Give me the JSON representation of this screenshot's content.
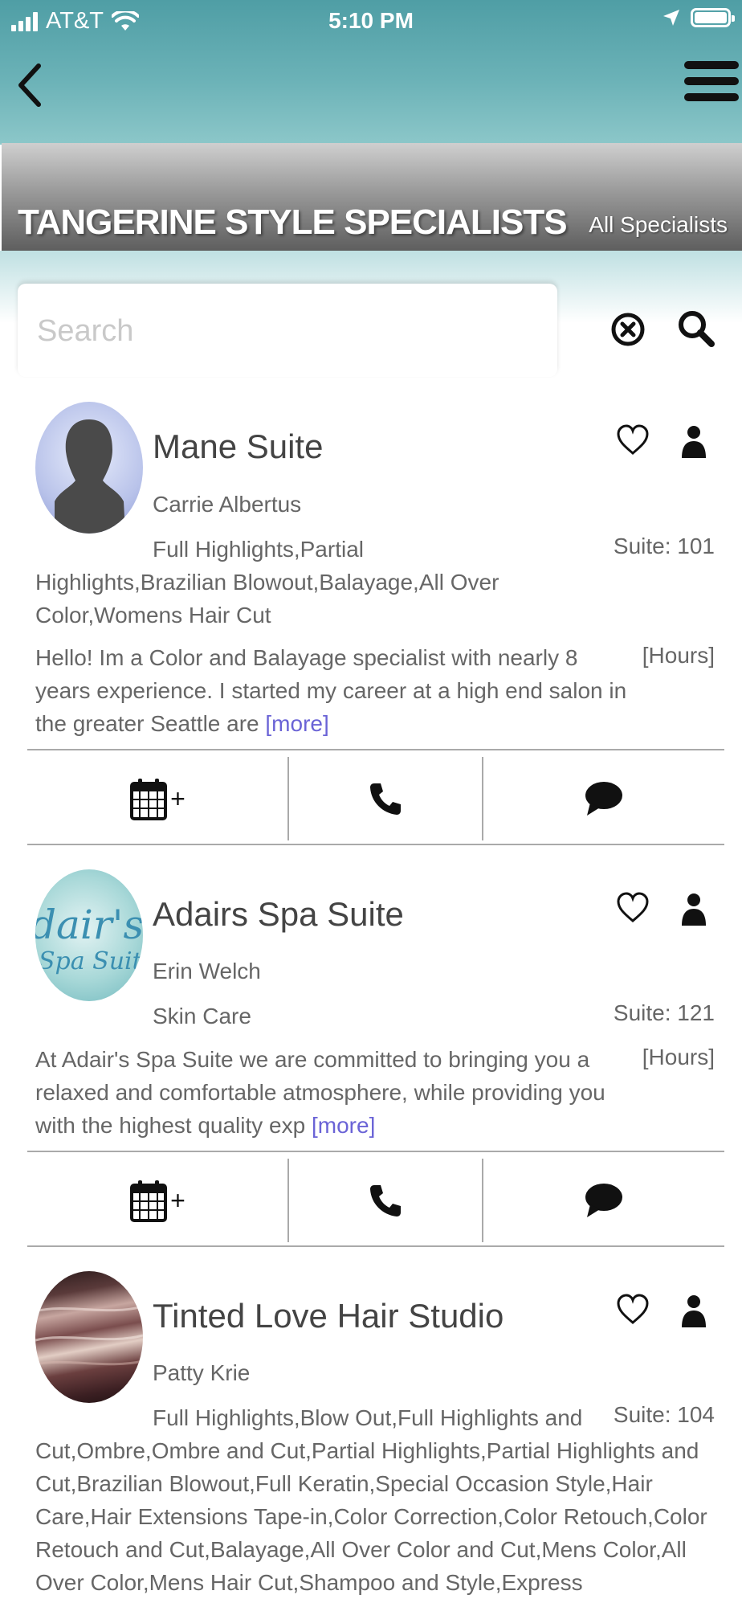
{
  "status_bar": {
    "carrier": "AT&T",
    "time": "5:10 PM"
  },
  "header": {
    "title": "TANGERINE STYLE SPECIALISTS",
    "all_specialists_label": "All Specialists"
  },
  "search": {
    "placeholder": "Search",
    "value": ""
  },
  "specialists": [
    {
      "business": "Mane Suite",
      "person": "Carrie Albertus",
      "services": "Full Highlights,Partial Highlights,Brazilian Blowout,Balayage,All Over Color,Womens Hair Cut",
      "suite": "Suite: 101",
      "about": "Hello! Im a Color and Balayage specialist with nearly 8 years experience. I started my career at a high end salon in the greater Seattle are",
      "more_label": "[more]",
      "hours_label": "[Hours]",
      "avatar_icon": "silhouette-avatar"
    },
    {
      "business": "Adairs Spa Suite",
      "person": "Erin Welch",
      "services": "Skin Care",
      "suite": "Suite: 121",
      "about": "At Adair's Spa Suite we are committed to bringing you a relaxed and comfortable atmosphere, while providing you with the highest quality exp",
      "more_label": "[more]",
      "hours_label": "[Hours]",
      "avatar_text": "Adair's Spa Suite"
    },
    {
      "business": "Tinted Love Hair Studio",
      "person": "Patty Krie",
      "services": "Full Highlights,Blow Out,Full Highlights and Cut,Ombre,Ombre and Cut,Partial Highlights,Partial Highlights and Cut,Brazilian Blowout,Full Keratin,Special Occasion Style,Hair Care,Hair Extensions Tape-in,Color Correction,Color Retouch,Color Retouch and Cut,Balayage,All Over Color and Cut,Mens Color,All Over Color,Mens Hair Cut,Shampoo and Style,Express",
      "suite": "Suite: 104",
      "avatar_icon": "hair-photo"
    }
  ],
  "actions": {
    "book_plus": "+"
  },
  "colors": {
    "header_teal": "#5aa6ac",
    "more_link": "#6a63d6"
  }
}
